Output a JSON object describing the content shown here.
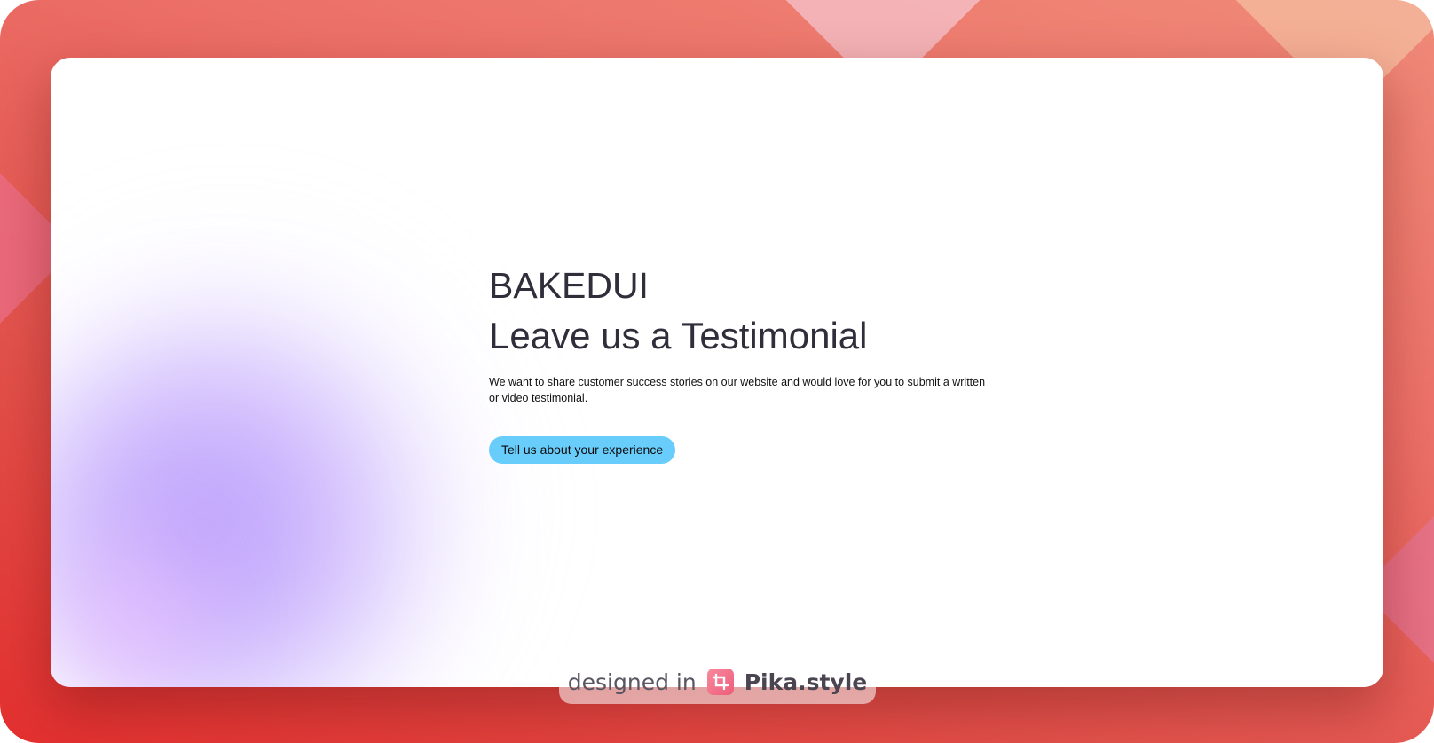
{
  "hero": {
    "brand": "BAKEDUI",
    "title": "Leave us a Testimonial",
    "description": "We want to share customer success stories on our website and would love for you to submit a written or video testimonial.",
    "cta_label": "Tell us about your experience"
  },
  "watermark": {
    "prefix": "designed in",
    "brand": "Pika.style",
    "icon": "crop-icon"
  },
  "colors": {
    "cta_background": "#68cdfa",
    "heading_text": "#2f2e3a",
    "frame_gradient_start": "#f08a78",
    "frame_gradient_end": "#e3302f",
    "blob_purple": "#b696fc",
    "logo_pink": "#ee5c7a"
  }
}
